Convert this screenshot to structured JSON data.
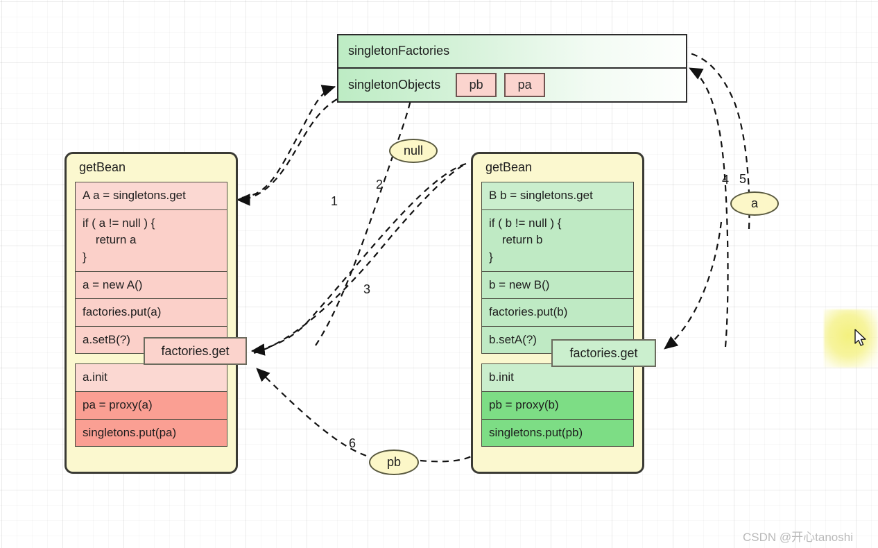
{
  "registry": {
    "rows": [
      {
        "label": "singletonFactories",
        "chips": []
      },
      {
        "label": "singletonObjects",
        "chips": [
          "pb",
          "pa"
        ]
      }
    ]
  },
  "panels": [
    {
      "id": "left",
      "title": "getBean",
      "groups": [
        {
          "rows": [
            {
              "text": "A a = singletons.get",
              "shade": "pink-1"
            },
            {
              "text": "if ( a != null ) {\n    return a\n}",
              "shade": "pink-2"
            },
            {
              "text": "a = new A()",
              "shade": "pink-2"
            },
            {
              "text": "factories.put(a)",
              "shade": "pink-2"
            },
            {
              "text": "a.setB(?)",
              "shade": "pink-2"
            }
          ]
        },
        {
          "rows": [
            {
              "text": "a.init",
              "shade": "pink-1"
            },
            {
              "text": "pa = proxy(a)",
              "shade": "pink-3"
            },
            {
              "text": "singletons.put(pa)",
              "shade": "pink-3"
            }
          ]
        }
      ],
      "overlay": "factories.get"
    },
    {
      "id": "right",
      "title": "getBean",
      "groups": [
        {
          "rows": [
            {
              "text": "B b = singletons.get",
              "shade": "green-1"
            },
            {
              "text": "if ( b != null ) {\n    return b\n}",
              "shade": "green-2"
            },
            {
              "text": "b = new B()",
              "shade": "green-2"
            },
            {
              "text": "factories.put(b)",
              "shade": "green-2"
            },
            {
              "text": "b.setA(?)",
              "shade": "green-2"
            }
          ]
        },
        {
          "rows": [
            {
              "text": "b.init",
              "shade": "green-1"
            },
            {
              "text": "pb = proxy(b)",
              "shade": "green-3"
            },
            {
              "text": "singletons.put(pb)",
              "shade": "green-3"
            }
          ]
        }
      ],
      "overlay": "factories.get"
    }
  ],
  "nodes": {
    "null_label": "null",
    "a_label": "a",
    "pb_label": "pb"
  },
  "steps": {
    "s1": "1",
    "s2": "2",
    "s3": "3",
    "s4": "4",
    "s5": "5",
    "s6": "6"
  },
  "watermark": "CSDN @开心tanoshi",
  "colors": {
    "registry_green": "#bdecc4",
    "panel_yellow": "#fbf8cf",
    "pink_light": "#fbd8d2",
    "pink_strong": "#fa9f93",
    "green_light": "#caeecd",
    "green_strong": "#7ddd85",
    "chip_pink": "#fbd4ce",
    "ellipse_yellow": "#fcf7c8",
    "arrow_black": "#111111",
    "watermark_gray": "#b9b9b9"
  }
}
